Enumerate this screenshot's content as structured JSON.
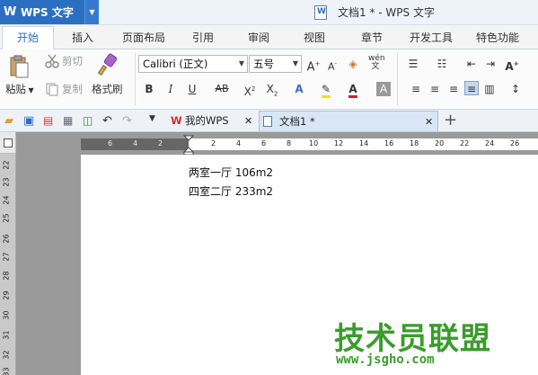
{
  "app": {
    "name": "WPS 文字",
    "window_title": "文档1 * - WPS 文字"
  },
  "ribbon_tabs": [
    "开始",
    "插入",
    "页面布局",
    "引用",
    "审阅",
    "视图",
    "章节",
    "开发工具",
    "特色功能"
  ],
  "ribbon": {
    "cut_label": "剪切",
    "paste_label": "粘贴",
    "copy_label": "复制",
    "format_painter_label": "格式刷",
    "font_name": "Calibri (正文)",
    "font_size": "五号"
  },
  "doc_tabs": [
    {
      "label": "我的WPS"
    },
    {
      "label": "文档1 *"
    }
  ],
  "ruler": {
    "h_labels": [
      "6",
      "4",
      "2",
      "2",
      "4",
      "6",
      "8",
      "10",
      "12",
      "14",
      "16",
      "18",
      "20",
      "22",
      "24",
      "26"
    ],
    "v_labels": [
      "22",
      "23",
      "24",
      "25",
      "26",
      "27",
      "28",
      "29",
      "30",
      "31",
      "32",
      "33"
    ]
  },
  "document": {
    "lines": [
      "两室一厅 106m2",
      "四室二厅 233m2"
    ]
  },
  "watermark": {
    "text": "技术员联盟",
    "url": "www.jsgho.com"
  }
}
